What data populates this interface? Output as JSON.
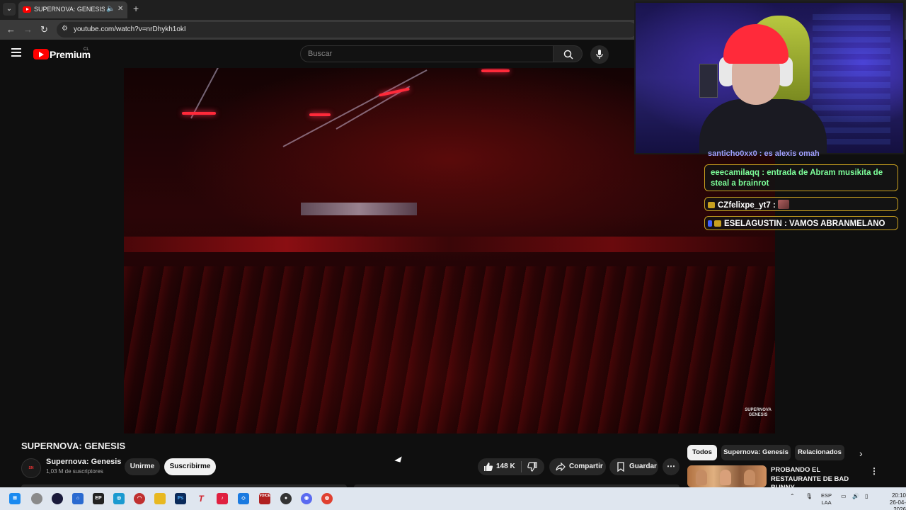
{
  "browser": {
    "tab_title": "SUPERNOVA: GENESIS - YouTube",
    "url": "youtube.com/watch?v=nrDhykh1okI"
  },
  "masthead": {
    "brand": "Premium",
    "country": "CL",
    "search_placeholder": "Buscar"
  },
  "video": {
    "watermark": "SUPERNOVA GENESIS"
  },
  "details": {
    "title": "SUPERNOVA: GENESIS",
    "channel_name": "Supernova: Genesis",
    "subscribers": "1,03 M de suscriptores",
    "join_label": "Unirme",
    "subscribe_label": "Suscribirme",
    "like_count": "148 K",
    "share_label": "Compartir",
    "save_label": "Guardar"
  },
  "chips": [
    "Todos",
    "Supernova: Genesis",
    "Relacionados"
  ],
  "recommendation": {
    "title": "PROBANDO EL RESTAURANTE DE BAD BUNNY"
  },
  "chat": {
    "partial": "santicho0xx0 : es alexis omah",
    "messages": [
      {
        "user": "eeecamilaqq",
        "text": "entrada de Abram musikita de steal a brainrot"
      },
      {
        "user": "CZfelixpe_yt7",
        "text": ""
      },
      {
        "user": "ESELAGUSTIN",
        "text": "VAMOS ABRANMELANO"
      }
    ]
  },
  "taskbar": {
    "lang_top": "ESP",
    "lang_bottom": "LAA",
    "time": "20:10",
    "date": "26-04-2026"
  },
  "colors": {
    "yt_red": "#ff0000",
    "background": "#0f0f0f",
    "chat_border": "#c8a020"
  }
}
